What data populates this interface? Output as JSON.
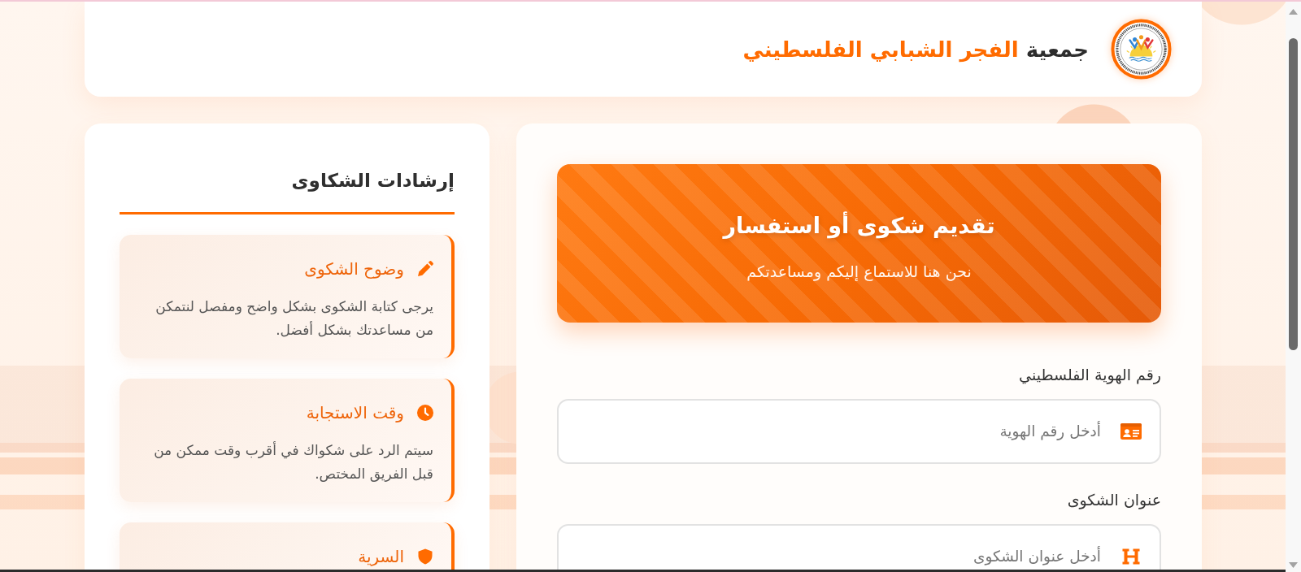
{
  "header": {
    "title": "جمعية **الفجر الشبابي الفلسطيني**"
  },
  "form": {
    "banner": {
      "title": "تقديم شكوى أو استفسار",
      "subtitle": "نحن هنا للاستماع إليكم ومساعدتكم"
    },
    "fields": [
      {
        "label": "رقم الهوية الفلسطيني",
        "placeholder": "أدخل رقم الهوية"
      },
      {
        "label": "عنوان الشكوى",
        "placeholder": "أدخل عنوان الشكوى"
      }
    ]
  },
  "guidelines": {
    "title": "إرشادات الشكاوى",
    "items": [
      {
        "heading": "وضوح الشكوى",
        "text": "يرجى كتابة الشكوى بشكل واضح ومفصل لنتمكن من مساعدتك بشكل أفضل."
      },
      {
        "heading": "وقت الاستجابة",
        "text": "سيتم الرد على شكواك في أقرب وقت ممكن من قبل الفريق المختص."
      },
      {
        "heading": "السرية"
      }
    ]
  }
}
